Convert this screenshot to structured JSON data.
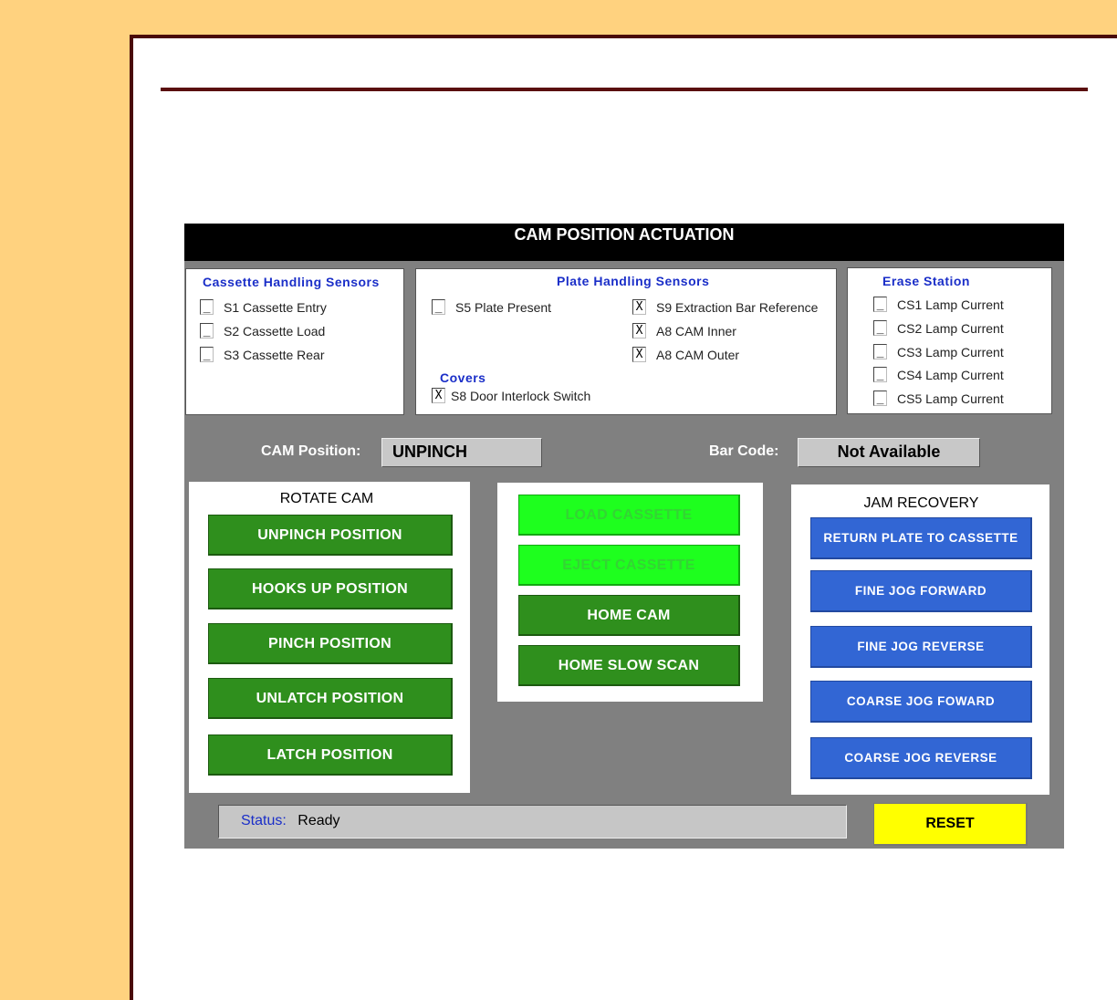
{
  "window": {
    "title": "CAM POSITION ACTUATION"
  },
  "cassette_sensors": {
    "title": "Cassette Handling Sensors",
    "items": [
      {
        "label": "S1 Cassette Entry",
        "mark": "_"
      },
      {
        "label": "S2 Cassette Load",
        "mark": "_"
      },
      {
        "label": "S3 Cassette Rear",
        "mark": "_"
      }
    ]
  },
  "plate_sensors": {
    "title": "Plate Handling Sensors",
    "items": [
      {
        "label": "S5 Plate Present",
        "mark": "_"
      },
      {
        "label": "S9 Extraction Bar Reference",
        "mark": "X"
      },
      {
        "label": "A8 CAM Inner",
        "mark": "X"
      },
      {
        "label": "A8 CAM Outer",
        "mark": "X"
      }
    ],
    "covers_title": "Covers",
    "covers_items": [
      {
        "label": "S8 Door Interlock Switch",
        "mark": "X"
      }
    ]
  },
  "erase_station": {
    "title": "Erase Station",
    "items": [
      {
        "label": "CS1 Lamp Current",
        "mark": "_"
      },
      {
        "label": "CS2 Lamp Current",
        "mark": "_"
      },
      {
        "label": "CS3 Lamp Current",
        "mark": "_"
      },
      {
        "label": "CS4 Lamp Current",
        "mark": "_"
      },
      {
        "label": "CS5 Lamp Current",
        "mark": "_"
      }
    ]
  },
  "cam_position": {
    "label": "CAM Position:",
    "value": "UNPINCH"
  },
  "bar_code": {
    "label": "Bar Code:",
    "value": "Not Available"
  },
  "rotate_cam": {
    "title": "ROTATE CAM",
    "buttons": [
      "UNPINCH POSITION",
      "HOOKS UP POSITION",
      "PINCH POSITION",
      "UNLATCH POSITION",
      "LATCH POSITION"
    ]
  },
  "cassette_actions": {
    "buttons": [
      "LOAD CASSETTE",
      "EJECT CASSETTE",
      "HOME CAM",
      "HOME SLOW SCAN"
    ]
  },
  "jam_recovery": {
    "title": "JAM RECOVERY",
    "buttons": [
      "RETURN PLATE TO CASSETTE",
      "FINE JOG FORWARD",
      "FINE JOG REVERSE",
      "COARSE JOG FOWARD",
      "COARSE JOG REVERSE"
    ]
  },
  "status": {
    "label": "Status:",
    "value": "Ready"
  },
  "reset_label": "RESET",
  "colors": {
    "page_background": "#ffd27f",
    "frame_border": "#4a0a0a",
    "title_bar": "#000000",
    "heading_blue": "#1a2ec8",
    "green_button": "#2f8f1d",
    "disabled_green_button": "#1eff1e",
    "blue_button": "#3266d4",
    "reset_button": "#ffff00"
  }
}
